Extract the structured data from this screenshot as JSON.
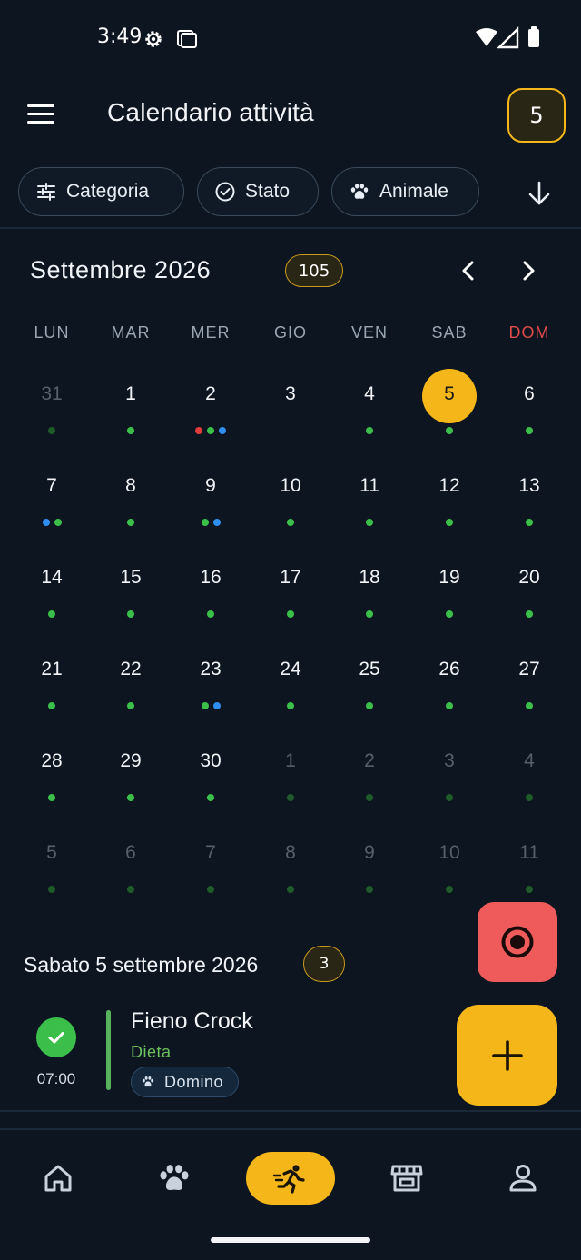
{
  "status_bar": {
    "time": "3:49",
    "icons": [
      "settings-icon",
      "screenshot-icon",
      "wifi-icon",
      "signal-icon",
      "battery-icon"
    ]
  },
  "app_bar": {
    "title": "Calendario attività",
    "count_badge": "5",
    "menu_icon": "hamburger-menu-icon"
  },
  "filters": [
    {
      "label": "Categoria",
      "icon": "sliders-icon"
    },
    {
      "label": "Stato",
      "icon": "check-circle-icon"
    },
    {
      "label": "Animale",
      "icon": "paw-icon"
    }
  ],
  "sort_icon": "arrow-down-icon",
  "calendar": {
    "month_title": "Settembre 2026",
    "month_count": "105",
    "weekdays": [
      "LUN",
      "MAR",
      "MER",
      "GIO",
      "VEN",
      "SAB",
      "DOM"
    ],
    "weeks": [
      [
        {
          "d": "31",
          "other": true,
          "dots": [
            "g"
          ]
        },
        {
          "d": "1",
          "dots": [
            "g"
          ]
        },
        {
          "d": "2",
          "dots": [
            "r",
            "g",
            "b"
          ]
        },
        {
          "d": "3",
          "dots": []
        },
        {
          "d": "4",
          "dots": [
            "g"
          ]
        },
        {
          "d": "5",
          "today": true,
          "dots": [
            "g"
          ]
        },
        {
          "d": "6",
          "dots": [
            "g"
          ]
        }
      ],
      [
        {
          "d": "7",
          "dots": [
            "b",
            "g"
          ]
        },
        {
          "d": "8",
          "dots": [
            "g"
          ]
        },
        {
          "d": "9",
          "dots": [
            "g",
            "b"
          ]
        },
        {
          "d": "10",
          "dots": [
            "g"
          ]
        },
        {
          "d": "11",
          "dots": [
            "g"
          ]
        },
        {
          "d": "12",
          "dots": [
            "g"
          ]
        },
        {
          "d": "13",
          "dots": [
            "g"
          ]
        }
      ],
      [
        {
          "d": "14",
          "dots": [
            "g"
          ]
        },
        {
          "d": "15",
          "dots": [
            "g"
          ]
        },
        {
          "d": "16",
          "dots": [
            "g"
          ]
        },
        {
          "d": "17",
          "dots": [
            "g"
          ]
        },
        {
          "d": "18",
          "dots": [
            "g"
          ]
        },
        {
          "d": "19",
          "dots": [
            "g"
          ]
        },
        {
          "d": "20",
          "dots": [
            "g"
          ]
        }
      ],
      [
        {
          "d": "21",
          "dots": [
            "g"
          ]
        },
        {
          "d": "22",
          "dots": [
            "g"
          ]
        },
        {
          "d": "23",
          "dots": [
            "g",
            "b"
          ]
        },
        {
          "d": "24",
          "dots": [
            "g"
          ]
        },
        {
          "d": "25",
          "dots": [
            "g"
          ]
        },
        {
          "d": "26",
          "dots": [
            "g"
          ]
        },
        {
          "d": "27",
          "dots": [
            "g"
          ]
        }
      ],
      [
        {
          "d": "28",
          "dots": [
            "g"
          ]
        },
        {
          "d": "29",
          "dots": [
            "g"
          ]
        },
        {
          "d": "30",
          "dots": [
            "g"
          ]
        },
        {
          "d": "1",
          "other": true,
          "dots": [
            "g"
          ]
        },
        {
          "d": "2",
          "other": true,
          "dots": [
            "g"
          ]
        },
        {
          "d": "3",
          "other": true,
          "dots": [
            "g"
          ]
        },
        {
          "d": "4",
          "other": true,
          "dots": [
            "g"
          ]
        }
      ],
      [
        {
          "d": "5",
          "other": true,
          "dots": [
            "g"
          ]
        },
        {
          "d": "6",
          "other": true,
          "dots": [
            "g"
          ]
        },
        {
          "d": "7",
          "other": true,
          "dots": [
            "g"
          ]
        },
        {
          "d": "8",
          "other": true,
          "dots": [
            "g"
          ]
        },
        {
          "d": "9",
          "other": true,
          "dots": [
            "g"
          ]
        },
        {
          "d": "10",
          "other": true,
          "dots": [
            "g"
          ]
        },
        {
          "d": "11",
          "other": true,
          "dots": [
            "g"
          ]
        }
      ]
    ]
  },
  "selected_day": {
    "title": "Sabato 5 settembre 2026",
    "count": "3"
  },
  "events": [
    {
      "time": "07:00",
      "title": "Fieno Crock",
      "category": "Dieta",
      "animal": "Domino",
      "status": "completed"
    }
  ],
  "fabs": {
    "record_icon": "record-icon",
    "add_icon": "plus-icon"
  },
  "bottom_nav": [
    {
      "name": "home",
      "icon": "home-icon"
    },
    {
      "name": "animals",
      "icon": "paw-icon"
    },
    {
      "name": "activities",
      "icon": "running-icon",
      "active": true
    },
    {
      "name": "shop",
      "icon": "store-icon"
    },
    {
      "name": "profile",
      "icon": "user-icon"
    }
  ],
  "colors": {
    "background": "#0c1520",
    "accent": "#f5b61a",
    "green": "#3bbf4a",
    "red": "#e23b3b",
    "blue": "#2f8ff0",
    "record": "#ef5b5b"
  }
}
